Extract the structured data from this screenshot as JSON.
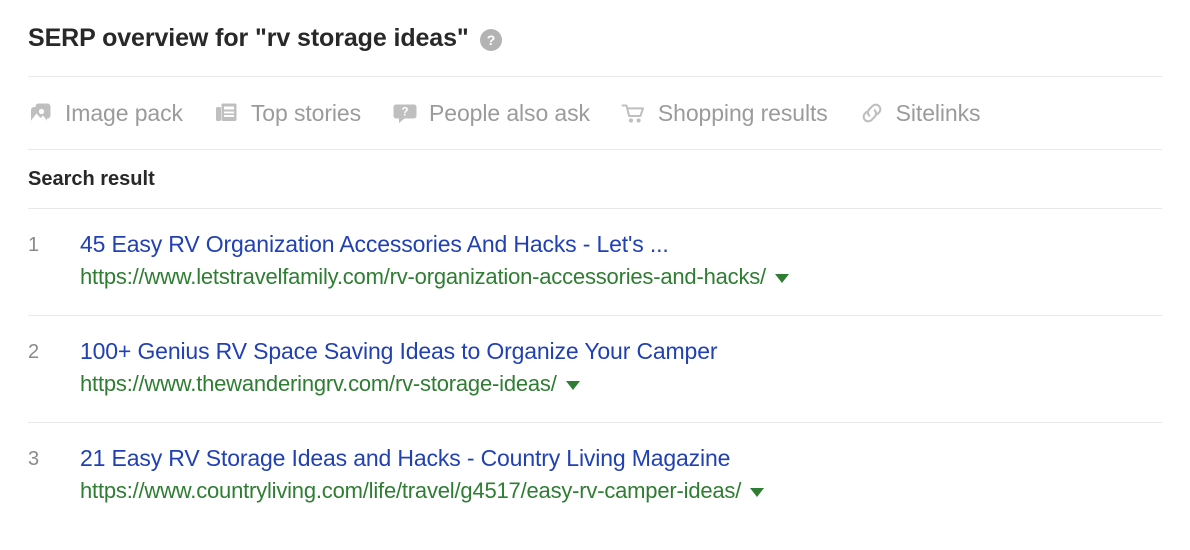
{
  "header": {
    "title": "SERP overview for \"rv storage ideas\"",
    "help_icon": "question-circle-icon"
  },
  "serp_features": {
    "items": [
      {
        "label": "Image pack",
        "icon": "image-pack-icon"
      },
      {
        "label": "Top stories",
        "icon": "top-stories-icon"
      },
      {
        "label": "People also ask",
        "icon": "people-also-ask-icon"
      },
      {
        "label": "Shopping results",
        "icon": "shopping-cart-icon"
      },
      {
        "label": "Sitelinks",
        "icon": "sitelinks-chain-icon"
      }
    ]
  },
  "results_section": {
    "title": "Search result",
    "rows": [
      {
        "rank": "1",
        "title": "45 Easy RV Organization Accessories And Hacks - Let's ...",
        "url": "https://www.letstravelfamily.com/rv-organization-accessories-and-hacks/"
      },
      {
        "rank": "2",
        "title": "100+ Genius RV Space Saving Ideas to Organize Your Camper",
        "url": "https://www.thewanderingrv.com/rv-storage-ideas/"
      },
      {
        "rank": "3",
        "title": "21 Easy RV Storage Ideas and Hacks - Country Living Magazine",
        "url": "https://www.countryliving.com/life/travel/g4517/easy-rv-camper-ideas/"
      }
    ]
  },
  "colors": {
    "title_blue": "#2140b4",
    "url_green": "#2e7d32",
    "feature_grey": "#9b9b9b",
    "heading_dark": "#282828",
    "divider": "#e8e8e8"
  }
}
